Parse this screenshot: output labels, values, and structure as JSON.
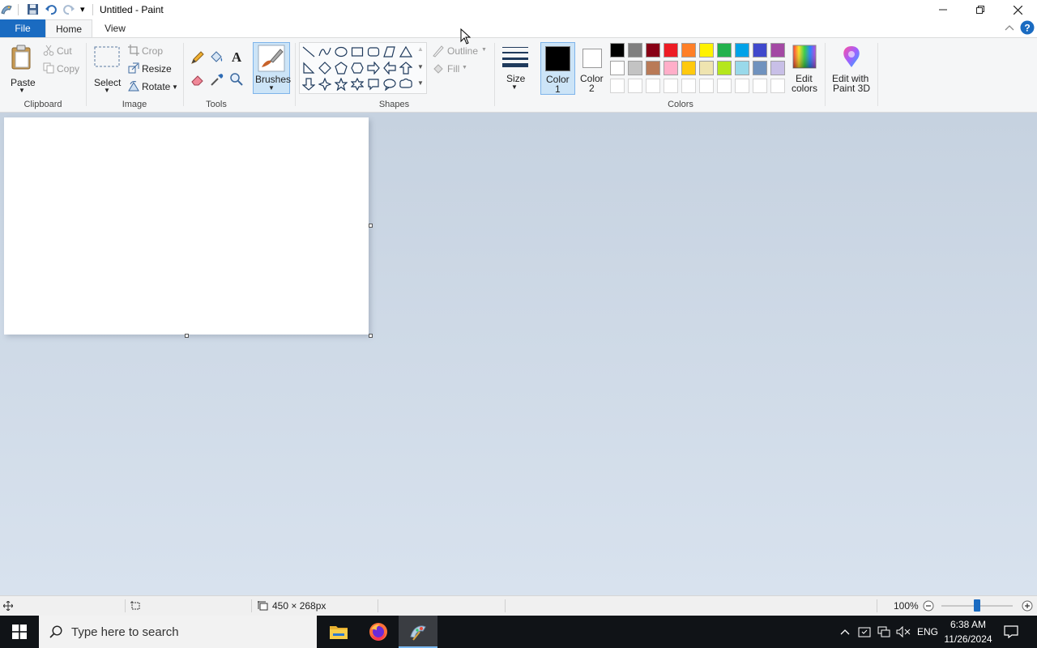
{
  "window": {
    "title": "Untitled - Paint",
    "quick_access_dropdown": "▾"
  },
  "tabs": [
    {
      "label": "File"
    },
    {
      "label": "Home"
    },
    {
      "label": "View"
    }
  ],
  "ribbon": {
    "clipboard": {
      "paste": "Paste",
      "cut": "Cut",
      "copy": "Copy",
      "group": "Clipboard"
    },
    "image": {
      "select": "Select",
      "crop": "Crop",
      "resize": "Resize",
      "rotate": "Rotate",
      "group": "Image"
    },
    "tools": {
      "group": "Tools"
    },
    "brushes": {
      "label": "Brushes"
    },
    "shapes": {
      "outline": "Outline",
      "fill": "Fill",
      "group": "Shapes"
    },
    "size": {
      "label": "Size"
    },
    "colors": {
      "color1": "Color",
      "color1_num": "1",
      "color2": "Color",
      "color2_num": "2",
      "edit_colors_1": "Edit",
      "edit_colors_2": "colors",
      "paint3d_1": "Edit with",
      "paint3d_2": "Paint 3D",
      "group": "Colors",
      "color1_value": "#000000",
      "color2_value": "#ffffff",
      "palette_row1": [
        "#000000",
        "#7f7f7f",
        "#880015",
        "#ed1c24",
        "#ff7f27",
        "#fff200",
        "#22b14c",
        "#00a2e8",
        "#3f48cc",
        "#a349a4"
      ],
      "palette_row2": [
        "#ffffff",
        "#c3c3c3",
        "#b97a57",
        "#ffaec9",
        "#ffc90e",
        "#efe4b0",
        "#b5e61d",
        "#99d9ea",
        "#7092be",
        "#c8bfe7"
      ]
    }
  },
  "status": {
    "image_size": "450 × 268px",
    "zoom": "100%",
    "zoom_level": 0.5
  },
  "taskbar": {
    "search_placeholder": "Type here to search",
    "language": "ENG",
    "time": "6:38 AM",
    "date": "11/26/2024"
  }
}
